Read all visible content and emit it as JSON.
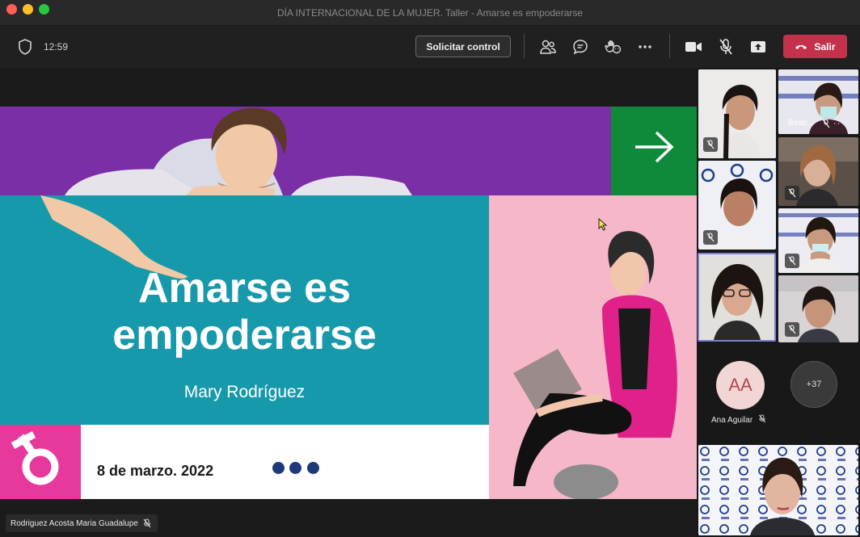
{
  "window": {
    "title": "DÍA INTERNACIONAL DE LA MUJER. Taller - Amarse es empoderarse"
  },
  "toolbar": {
    "timer": "12:59",
    "request_control_label": "Solicitar control",
    "leave_label": "Salir",
    "icons": [
      "shield-icon",
      "people-icon",
      "chat-icon",
      "reactions-icon",
      "more-icon",
      "camera-icon",
      "mic-muted-icon",
      "share-icon",
      "phone-icon"
    ]
  },
  "slide": {
    "title_line1": "Amarse es",
    "title_line2": "empoderarse",
    "author": "Mary Rodríguez",
    "date": "8 de marzo. 2022",
    "colors": {
      "purple": "#7b2fa6",
      "green": "#0e8a3a",
      "teal": "#1799ac",
      "pink": "#f6b7c8",
      "magenta": "#e6399b",
      "dots": "#1f3a78"
    }
  },
  "participants": {
    "named_tile": "Beatr...",
    "avatar_initials": "AA",
    "avatar_name": "Ana Aguilar",
    "overflow_count": "+37"
  },
  "presenter": {
    "name": "Rodriguez Acosta Maria Guadalupe"
  },
  "theme": {
    "leave_color": "#c4314b",
    "background": "#1f1f1f"
  }
}
